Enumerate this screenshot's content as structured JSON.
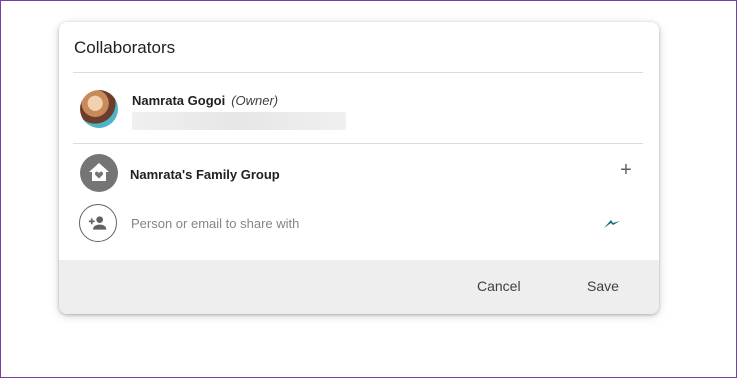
{
  "dialog": {
    "title": "Collaborators"
  },
  "owner": {
    "name": "Namrata Gogoi",
    "role": "(Owner)"
  },
  "group": {
    "name": "Namrata's Family Group"
  },
  "share": {
    "placeholder": "Person or email to share with"
  },
  "footer": {
    "cancel_label": "Cancel",
    "save_label": "Save"
  },
  "colors": {
    "frame_border": "#7b3fa3",
    "footer_bg": "#eeeeee",
    "group_icon_bg": "#757575",
    "cursor_color": "#0b6e7a"
  }
}
